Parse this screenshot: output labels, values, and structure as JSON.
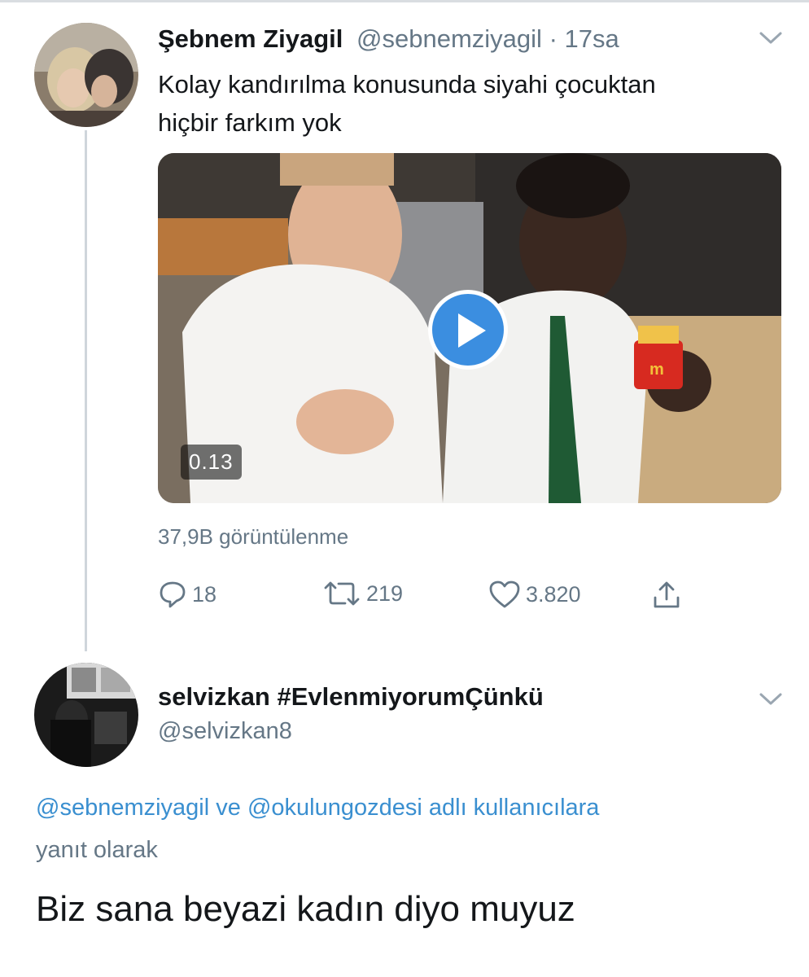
{
  "tweet": {
    "author_name": "Şebnem Ziyagil",
    "author_handle": "@sebnemziyagil",
    "separator": "·",
    "time": "17sa",
    "text_line1": "Kolay kandırılma konusunda siyahi çocuktan",
    "text_line2": "hiçbir farkım yok",
    "video": {
      "duration": "0.13",
      "play_icon": "play-icon"
    },
    "views": "37,9B görüntülenme",
    "actions": {
      "replies": "18",
      "retweets": "219",
      "likes": "3.820"
    },
    "icons": [
      "reply-icon",
      "retweet-icon",
      "like-icon",
      "share-icon",
      "chevron-down-icon"
    ]
  },
  "reply": {
    "author_name": "selvizkan #EvlenmiyorumÇünkü",
    "author_handle": "@selvizkan8",
    "reply_to_user1": "@sebnemziyagil",
    "reply_to_connector": " ve ",
    "reply_to_user2": "@okulungozdesi",
    "reply_to_suffix": " adlı kullanıcılara",
    "reply_to_line2": "yanıt olarak",
    "text": "Biz sana beyazi kadın diyo muyuz"
  },
  "colors": {
    "text": "#14171a",
    "muted": "#657786",
    "link": "#3a8fd0",
    "play": "#3b8ee0",
    "thread_line": "#cfd5db"
  }
}
